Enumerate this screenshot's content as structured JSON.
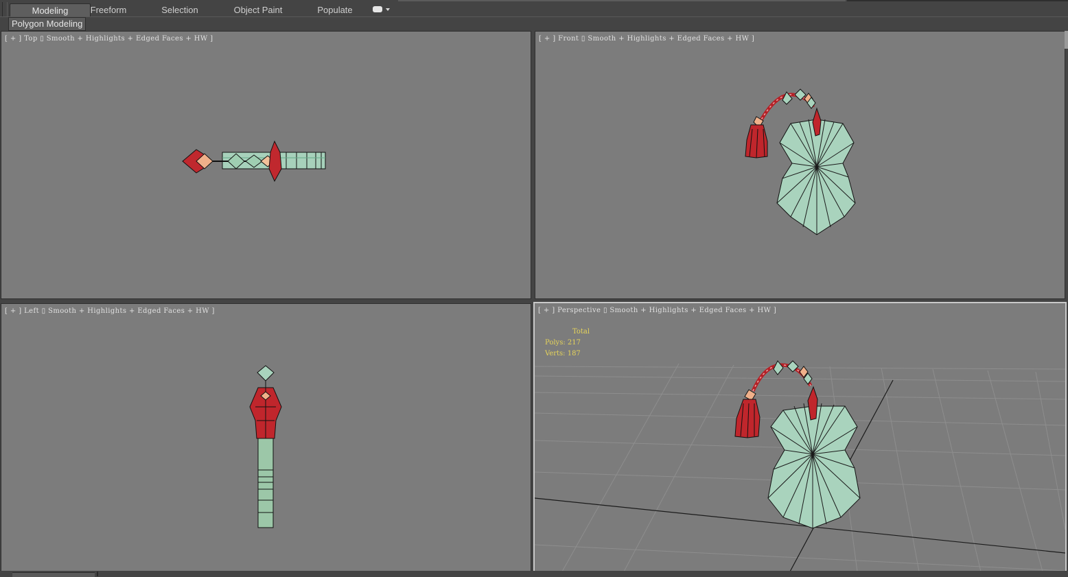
{
  "ribbon": {
    "tabs": [
      {
        "label": "Modeling",
        "active": true
      },
      {
        "label": "Freeform",
        "active": false
      },
      {
        "label": "Selection",
        "active": false
      },
      {
        "label": "Object Paint",
        "active": false
      },
      {
        "label": "Populate",
        "active": false
      }
    ],
    "extra_icon": "camera-dropdown-icon",
    "panel_label": "Polygon Modeling"
  },
  "viewports": {
    "top": {
      "plus": "[ + ]",
      "view": "Top",
      "mode": "Smooth + Highlights + Edged Faces + HW ]"
    },
    "front": {
      "plus": "[ + ]",
      "view": "Front",
      "mode": "Smooth + Highlights + Edged Faces + HW ]"
    },
    "left": {
      "plus": "[ + ]",
      "view": "Left",
      "mode": "Smooth + Highlights + Edged Faces + HW ]"
    },
    "perspective": {
      "plus": "[ + ]",
      "view": "Perspective",
      "mode": "Smooth + Highlights + Edged Faces + HW ]",
      "active": true
    }
  },
  "stats": {
    "total_label": "Total",
    "polys": "Polys: 217",
    "verts": "Verts: 187"
  },
  "colors": {
    "viewport_bg": "#7c7c7c",
    "jade": "#a9d3bd",
    "tassel_red": "#c0262c",
    "bead_peach": "#f0b08a",
    "stats_yellow": "#e6d45a"
  }
}
